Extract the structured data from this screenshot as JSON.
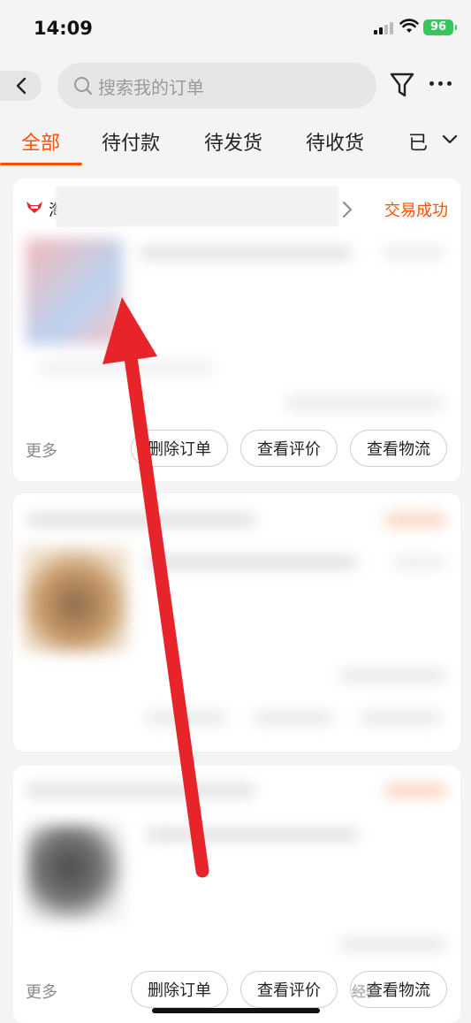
{
  "status_bar": {
    "time": "14:09",
    "battery": "96"
  },
  "search": {
    "placeholder": "搜索我的订单"
  },
  "tabs": [
    {
      "label": "全部",
      "active": true
    },
    {
      "label": "待付款"
    },
    {
      "label": "待发货"
    },
    {
      "label": "待收货"
    },
    {
      "label": "已"
    }
  ],
  "orders": [
    {
      "shop_name": "淘",
      "status": "交易成功",
      "more_label": "更多",
      "actions": [
        "删除订单",
        "查看评价",
        "查看物流"
      ]
    },
    {
      "more_label": "",
      "actions": []
    },
    {
      "more_label": "更多",
      "actions": [
        "删除订单",
        "查看评价",
        "查看物流"
      ]
    }
  ],
  "watermark_text": "经验",
  "colors": {
    "accent": "#ff5000",
    "annotation_arrow": "#e8242b"
  }
}
